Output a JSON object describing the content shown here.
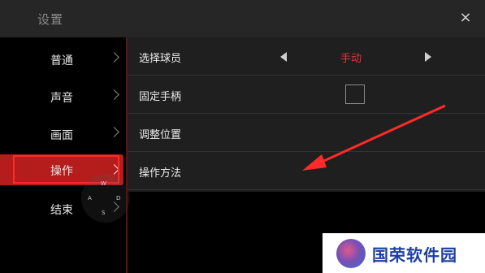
{
  "header": {
    "title": "设置",
    "close_glyph": "×"
  },
  "sidebar": {
    "items": [
      {
        "label": "普通"
      },
      {
        "label": "声音"
      },
      {
        "label": "画面"
      },
      {
        "label": "操作",
        "active": true
      },
      {
        "label": "结束"
      }
    ]
  },
  "joystick": {
    "up": "W",
    "left": "A",
    "right": "D",
    "down": "S"
  },
  "settings": {
    "select_player": {
      "label": "选择球员",
      "value": "手动"
    },
    "fixed_controller": {
      "label": "固定手柄",
      "checked": false
    },
    "adjust_position": {
      "label": "调整位置"
    },
    "controls": {
      "label": "操作方法"
    }
  },
  "watermark": {
    "text": "国荣软件园"
  },
  "colors": {
    "accent": "#b51c1c",
    "annotation": "#ff2a2a",
    "value": "#d83a3a"
  }
}
